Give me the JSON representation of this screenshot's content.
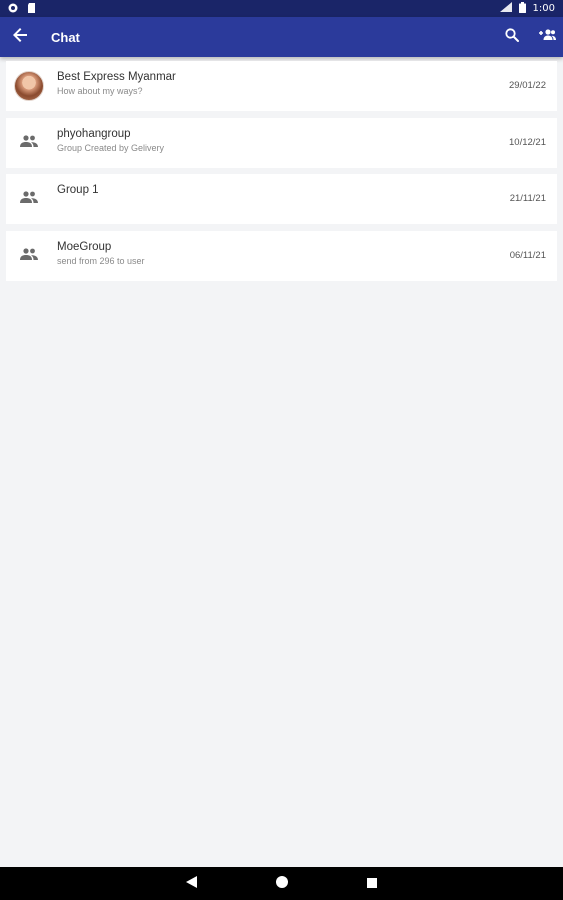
{
  "status_bar": {
    "time": "1:00",
    "icons": [
      "notification-icon",
      "sd-card-icon",
      "signal-icon",
      "battery-icon"
    ]
  },
  "app_bar": {
    "title": "Chat",
    "back_icon": "arrow-back-icon",
    "search_icon": "search-icon",
    "add_group_icon": "group-add-icon",
    "color": "#2b3a9b"
  },
  "chats": [
    {
      "name": "Best Express Myanmar",
      "subtitle": "How about my ways?",
      "date": "29/01/22",
      "avatar": "photo"
    },
    {
      "name": "phyohangroup",
      "subtitle": "Group Created by Gelivery",
      "date": "10/12/21",
      "avatar": "group-icon"
    },
    {
      "name": "Group 1",
      "subtitle": "",
      "date": "21/11/21",
      "avatar": "group-icon"
    },
    {
      "name": "MoeGroup",
      "subtitle": "send from 296 to user",
      "date": "06/11/21",
      "avatar": "group-icon"
    }
  ],
  "nav_bar": {
    "icons": [
      "back-triangle-icon",
      "home-circle-icon",
      "recents-square-icon"
    ]
  }
}
